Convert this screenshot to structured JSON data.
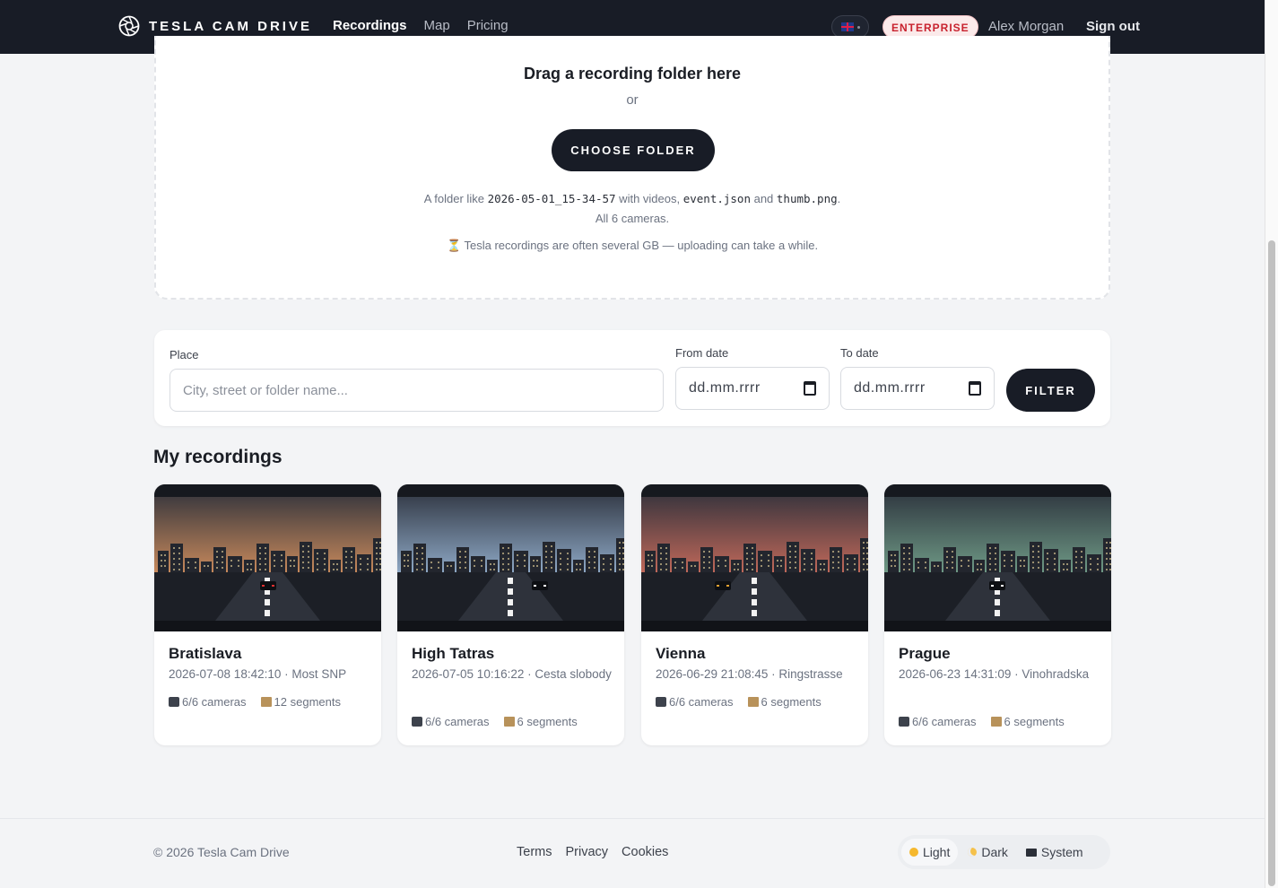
{
  "header": {
    "brand": "TESLA CAM DRIVE",
    "nav": [
      {
        "label": "Recordings",
        "active": true
      },
      {
        "label": "Map",
        "active": false
      },
      {
        "label": "Pricing",
        "active": false
      }
    ],
    "language_icon": "uk-flag-icon",
    "plan_badge": "ENTERPRISE",
    "user_name": "Alex Morgan",
    "sign_out": "Sign out"
  },
  "upload": {
    "title": "Drag a recording folder here",
    "or": "or",
    "button": "CHOOSE FOLDER",
    "hint_prefix": "A folder like ",
    "hint_folder": "2026-05-01_15-34-57",
    "hint_mid": " with videos, ",
    "hint_file1": "event.json",
    "hint_and": " and ",
    "hint_file2": "thumb.png",
    "hint_suffix": ".",
    "hint_line2": "All 6 cameras.",
    "warning": "⏳ Tesla recordings are often several GB — uploading can take a while."
  },
  "filter": {
    "place_label": "Place",
    "place_placeholder": "City, street or folder name...",
    "from_label": "From date",
    "from_value": "dd.mm.rrrr",
    "to_label": "To date",
    "to_value": "dd.mm.rrrr",
    "button": "FILTER"
  },
  "recordings": {
    "title": "My recordings",
    "items": [
      {
        "place": "Bratislava",
        "meta": "2026-07-08 18:42:10 · Most SNP",
        "cameras": "6/6 cameras",
        "segments": "12 segments",
        "sky": "#c98a5c"
      },
      {
        "place": "High Tatras",
        "meta": "2026-07-05 10:16:22 · Cesta slobody",
        "cameras": "6/6 cameras",
        "segments": "6 segments",
        "sky": "#8fa9c6"
      },
      {
        "place": "Vienna",
        "meta": "2026-06-29 21:08:45 · Ringstrasse",
        "cameras": "6/6 cameras",
        "segments": "6 segments",
        "sky": "#c2695a"
      },
      {
        "place": "Prague",
        "meta": "2026-06-23 14:31:09 · Vinohradska",
        "cameras": "6/6 cameras",
        "segments": "6 segments",
        "sky": "#6f9a86"
      }
    ]
  },
  "footer": {
    "copyright": "© 2026 Tesla Cam Drive",
    "links": [
      "Terms",
      "Privacy",
      "Cookies"
    ],
    "themes": [
      {
        "label": "Light",
        "icon": "sun-icon",
        "active": true
      },
      {
        "label": "Dark",
        "icon": "moon-icon",
        "active": false
      },
      {
        "label": "System",
        "icon": "monitor-icon",
        "active": false
      }
    ]
  }
}
